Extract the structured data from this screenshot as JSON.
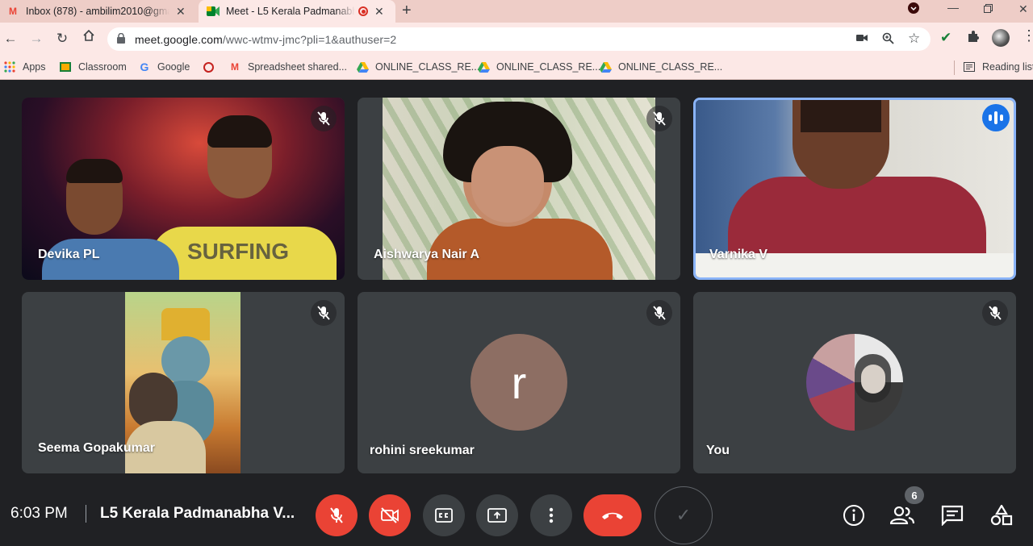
{
  "browser": {
    "tabs": [
      {
        "title": "Inbox (878) - ambilim2010@gma",
        "close": "✕"
      },
      {
        "title": "Meet - L5 Kerala Padmanabh",
        "close": "✕"
      }
    ],
    "new_tab": "+",
    "url_host": "meet.google.com",
    "url_path": "/wwc-wtmv-jmc?pli=1&authuser=2",
    "bookmarks": [
      {
        "label": "Apps"
      },
      {
        "label": "Classroom"
      },
      {
        "label": "Google"
      },
      {
        "label": "Spreadsheet shared..."
      },
      {
        "label": "ONLINE_CLASS_RE..."
      },
      {
        "label": "ONLINE_CLASS_RE..."
      },
      {
        "label": "ONLINE_CLASS_RE..."
      }
    ],
    "reading_list": "Reading list"
  },
  "participants": [
    {
      "name": "Devika PL",
      "muted": true
    },
    {
      "name": "Aishwarya Nair A",
      "muted": true
    },
    {
      "name": "Varnika V",
      "speaking": true
    },
    {
      "name": "Seema Gopakumar",
      "muted": true
    },
    {
      "name": "rohini sreekumar",
      "muted": true,
      "initial": "r",
      "avatar_color": "#8d6e63"
    },
    {
      "name": "You",
      "muted": true
    }
  ],
  "controls": {
    "time": "6:03 PM",
    "meeting_title": "L5 Kerala Padmanabha V...",
    "people_count": "6"
  },
  "colors": {
    "accent_red": "#ea4335",
    "speaking_blue": "#1a73e8",
    "tile_bg": "#3c4043",
    "page_bg": "#202124"
  }
}
